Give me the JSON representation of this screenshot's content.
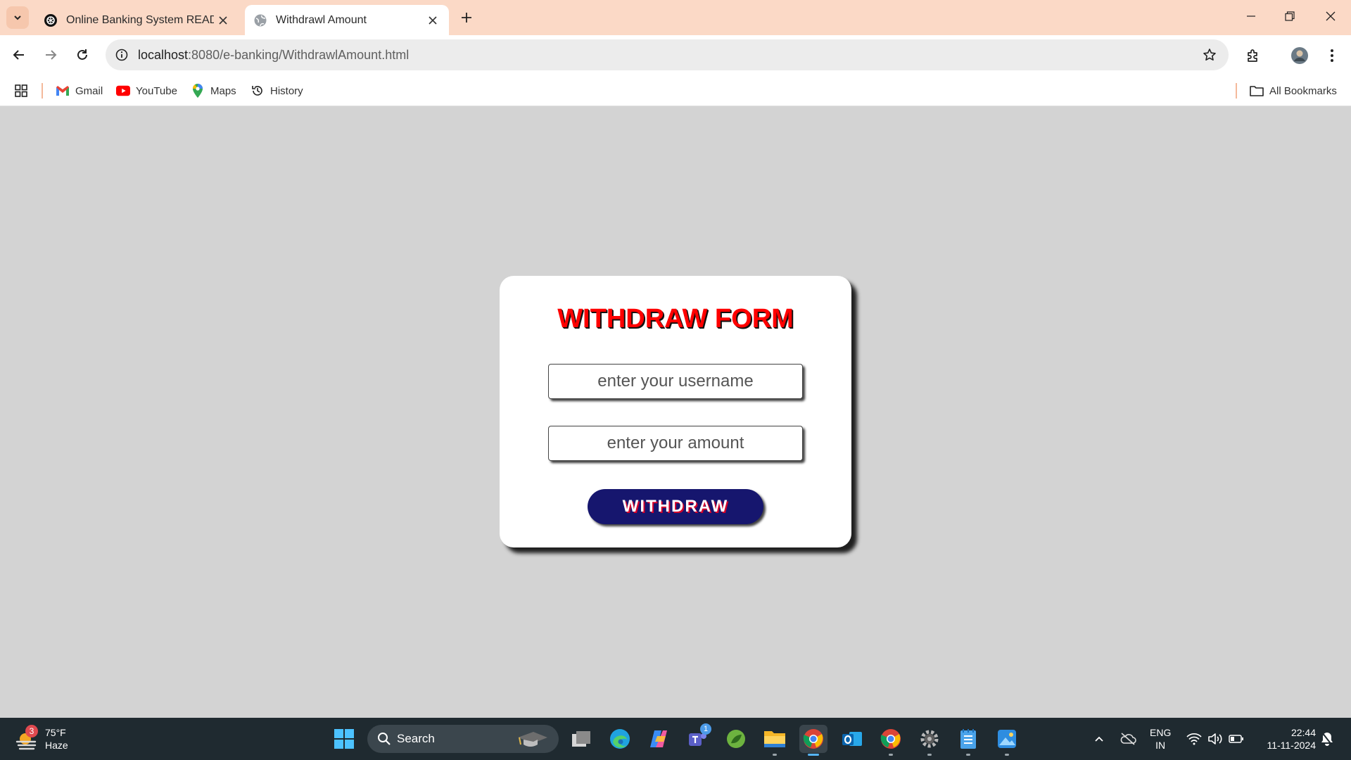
{
  "browser": {
    "tabs": [
      {
        "title": "Online Banking System READM"
      },
      {
        "title": "Withdrawl Amount"
      }
    ],
    "url_host": "localhost",
    "url_path": ":8080/e-banking/WithdrawlAmount.html",
    "bookmarks": [
      {
        "label": "Gmail"
      },
      {
        "label": "YouTube"
      },
      {
        "label": "Maps"
      },
      {
        "label": "History"
      }
    ],
    "all_bookmarks_label": "All Bookmarks"
  },
  "form": {
    "title": "WITHDRAW FORM",
    "username_placeholder": "enter your username",
    "amount_placeholder": "enter your amount",
    "submit_label": "WITHDRAW"
  },
  "taskbar": {
    "weather_temp": "75°F",
    "weather_desc": "Haze",
    "weather_badge": "3",
    "search_label": "Search",
    "teams_badge": "1",
    "lang_line1": "ENG",
    "lang_line2": "IN",
    "time": "22:44",
    "date": "11-11-2024"
  },
  "colors": {
    "page_background": "#d3d3d3",
    "title_red": "#ff0000",
    "button_navy": "#16166e",
    "tabbar": "#fbd9c6",
    "taskbar": "#1f2a30"
  }
}
